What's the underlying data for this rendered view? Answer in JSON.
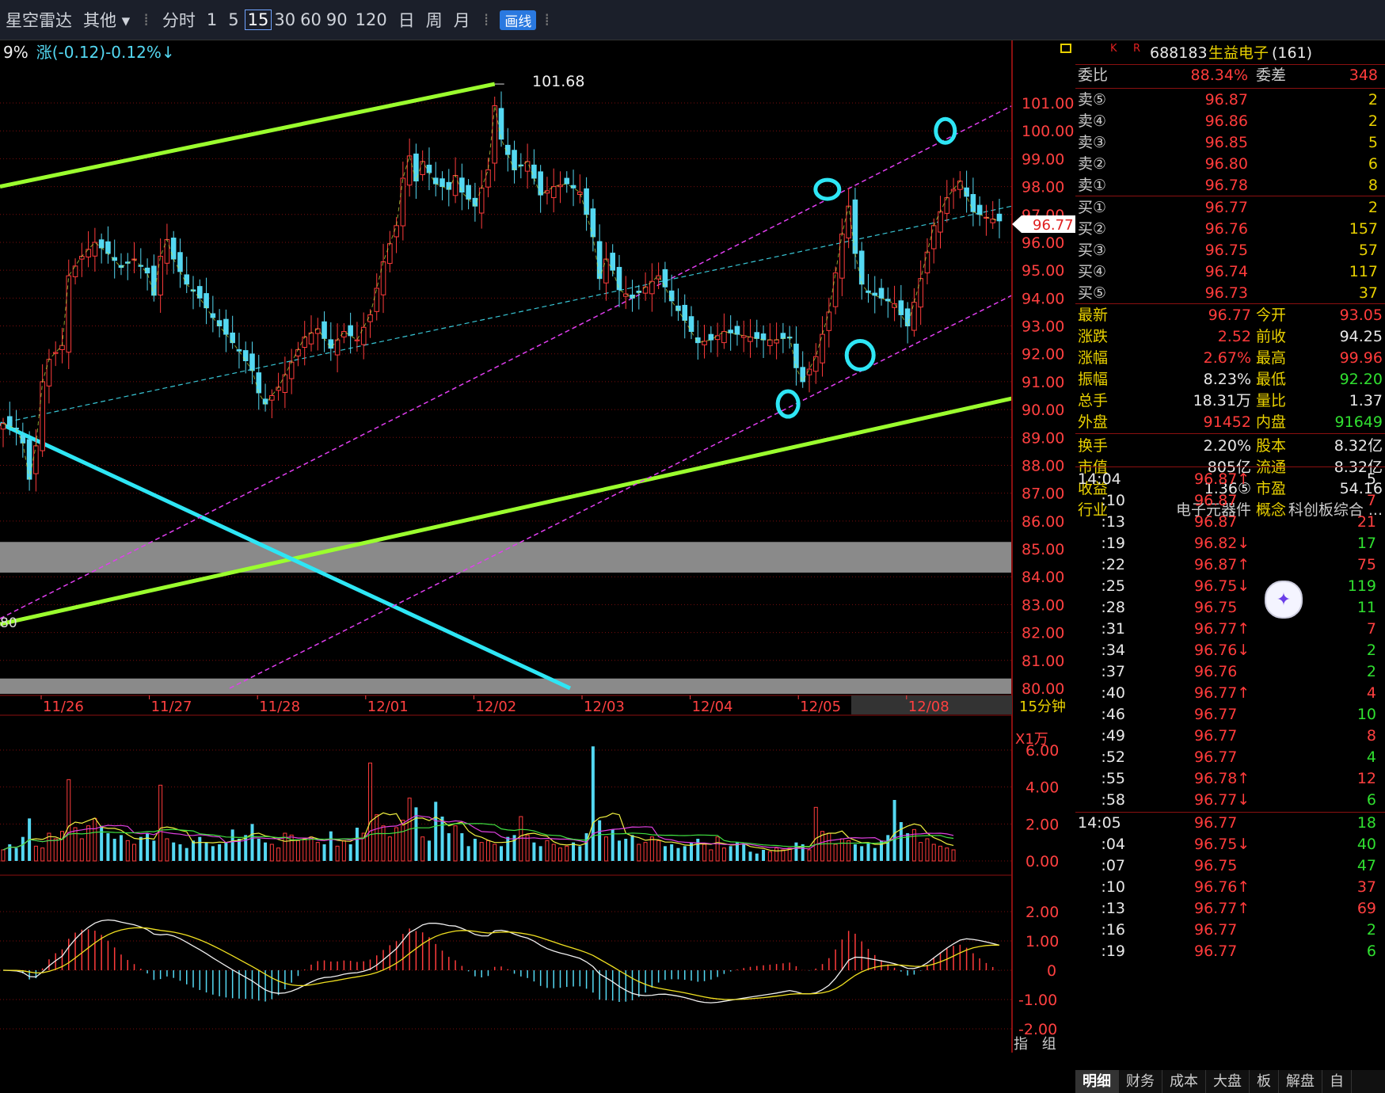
{
  "toolbar": {
    "app_name": "星空雷达",
    "menu_other": "其他",
    "periods": [
      "分时",
      "1",
      "5",
      "15",
      "30",
      "60",
      "90",
      "120",
      "日",
      "周",
      "月"
    ],
    "selected_period": "15",
    "draw_label": "画线"
  },
  "chart_header": {
    "pct_fragment": "9%",
    "change_text": "涨(-0.12)-0.12%↓"
  },
  "chart_data": {
    "type": "candlestick",
    "period_label": "15分钟",
    "x_labels": [
      "11/26",
      "11/27",
      "11/28",
      "12/01",
      "12/02",
      "12/03",
      "12/04",
      "12/05",
      "12/08"
    ],
    "price_ticks": [
      "101.00",
      "100.00",
      "99.00",
      "98.00",
      "97.00",
      "96.00",
      "95.00",
      "94.00",
      "93.00",
      "92.00",
      "91.00",
      "90.00",
      "89.00",
      "88.00",
      "87.00",
      "86.00",
      "85.00",
      "84.00",
      "83.00",
      "82.00",
      "81.00",
      "80.00"
    ],
    "ylim": [
      80,
      102
    ],
    "high_marker": "101.68",
    "current_price": "96.77",
    "left_edge_label": "80",
    "close_path": [
      [
        0,
        89.5
      ],
      [
        2,
        89.3
      ],
      [
        3,
        88.8
      ],
      [
        4,
        87.5
      ],
      [
        5,
        88.7
      ],
      [
        6,
        91.0
      ],
      [
        7,
        91.8
      ],
      [
        9,
        92.3
      ],
      [
        10,
        94.8
      ],
      [
        12,
        95.5
      ],
      [
        14,
        96.0
      ],
      [
        16,
        95.6
      ],
      [
        18,
        95.1
      ],
      [
        20,
        95.4
      ],
      [
        22,
        94.9
      ],
      [
        23,
        94.1
      ],
      [
        24,
        95.5
      ],
      [
        25,
        96.1
      ],
      [
        26,
        95.4
      ],
      [
        28,
        94.5
      ],
      [
        30,
        94.0
      ],
      [
        32,
        93.3
      ],
      [
        34,
        92.7
      ],
      [
        36,
        92.1
      ],
      [
        38,
        91.4
      ],
      [
        39,
        90.6
      ],
      [
        40,
        90.2
      ],
      [
        42,
        90.8
      ],
      [
        44,
        91.7
      ],
      [
        46,
        92.6
      ],
      [
        48,
        92.9
      ],
      [
        50,
        92.2
      ],
      [
        52,
        92.8
      ],
      [
        54,
        92.5
      ],
      [
        56,
        93.4
      ],
      [
        58,
        95.3
      ],
      [
        60,
        96.6
      ],
      [
        61,
        98.3
      ],
      [
        62,
        99.1
      ],
      [
        63,
        98.2
      ],
      [
        64,
        98.9
      ],
      [
        66,
        98.1
      ],
      [
        68,
        97.9
      ],
      [
        69,
        98.4
      ],
      [
        70,
        97.8
      ],
      [
        72,
        97.3
      ],
      [
        74,
        98.6
      ],
      [
        75,
        100.9
      ],
      [
        76,
        99.7
      ],
      [
        78,
        98.6
      ],
      [
        80,
        98.9
      ],
      [
        82,
        97.7
      ],
      [
        84,
        98.0
      ],
      [
        86,
        98.1
      ],
      [
        88,
        97.8
      ],
      [
        90,
        96.2
      ],
      [
        91,
        94.7
      ],
      [
        92,
        95.4
      ],
      [
        93,
        95.0
      ],
      [
        94,
        94.3
      ],
      [
        96,
        94.0
      ],
      [
        98,
        94.4
      ],
      [
        100,
        94.8
      ],
      [
        101,
        94.4
      ],
      [
        102,
        93.9
      ],
      [
        104,
        93.2
      ],
      [
        106,
        92.4
      ],
      [
        108,
        92.5
      ],
      [
        110,
        92.8
      ],
      [
        112,
        92.7
      ],
      [
        114,
        92.6
      ],
      [
        116,
        92.5
      ],
      [
        118,
        92.5
      ],
      [
        120,
        92.6
      ],
      [
        121,
        91.5
      ],
      [
        122,
        91.0
      ],
      [
        124,
        91.9
      ],
      [
        126,
        93.5
      ],
      [
        128,
        96.3
      ],
      [
        129,
        97.3
      ],
      [
        130,
        95.6
      ],
      [
        131,
        94.5
      ],
      [
        132,
        94.2
      ],
      [
        134,
        94.0
      ],
      [
        136,
        93.8
      ],
      [
        138,
        93.0
      ],
      [
        140,
        94.7
      ],
      [
        142,
        96.6
      ],
      [
        144,
        97.6
      ],
      [
        146,
        98.2
      ],
      [
        148,
        97.1
      ],
      [
        150,
        96.9
      ],
      [
        152,
        96.77
      ]
    ],
    "volume": {
      "scale_label": "X1万",
      "ticks": [
        "6.00",
        "4.00",
        "2.00",
        "0.00"
      ],
      "ylim": [
        0,
        7
      ],
      "values": [
        0.6,
        0.9,
        0.7,
        1.3,
        2.3,
        0.8,
        0.7,
        1.5,
        1.2,
        1.6,
        4.4,
        1.8,
        1.2,
        1.9,
        2.3,
        1.9,
        1.5,
        1.2,
        1.4,
        1.1,
        0.9,
        1.3,
        1.5,
        1.1,
        4.1,
        1.2,
        1.0,
        0.9,
        0.7,
        1.1,
        1.3,
        1.0,
        0.8,
        0.9,
        1.0,
        1.7,
        1.2,
        1.4,
        2.0,
        1.2,
        1.0,
        0.9,
        0.7,
        1.5,
        1.4,
        1.1,
        1.2,
        1.3,
        1.0,
        0.9,
        1.6,
        0.8,
        1.1,
        0.9,
        1.8,
        1.5,
        5.3,
        2.5,
        1.9,
        1.3,
        1.8,
        2.2,
        3.4,
        2.9,
        1.3,
        1.1,
        3.2,
        2.4,
        1.5,
        1.9,
        1.5,
        0.8,
        1.2,
        1.0,
        1.1,
        0.9,
        0.8,
        1.3,
        1.4,
        2.4,
        1.4,
        1.0,
        0.8,
        1.1,
        0.9,
        0.7,
        0.8,
        1.0,
        0.8,
        1.5,
        6.2,
        2.2,
        1.3,
        1.7,
        1.1,
        1.2,
        1.4,
        0.9,
        1.0,
        1.3,
        1.1,
        0.8,
        0.9,
        0.7,
        0.8,
        1.0,
        1.2,
        0.9,
        0.6,
        1.3,
        0.7,
        0.8,
        1.0,
        0.9,
        0.5,
        0.4,
        0.6,
        0.5,
        0.7,
        0.6,
        0.7,
        1.0,
        0.9,
        0.6,
        2.9,
        1.6,
        1.5,
        0.9,
        1.2,
        1.1,
        0.9,
        0.8,
        1.0,
        0.7,
        1.1,
        1.4,
        3.3,
        2.1,
        1.5,
        1.7,
        1.0,
        1.2,
        0.9,
        0.8,
        0.7,
        0.6
      ]
    },
    "macd": {
      "ticks": [
        "2.00",
        "1.00",
        "0",
        "-1.00",
        "-2.00"
      ],
      "ylim": [
        -2.2,
        2.2
      ]
    }
  },
  "info_panel": {
    "tabs_top": [
      "K",
      "R"
    ],
    "code": "688183",
    "name": "生益电子",
    "name_suffix": "(161)",
    "webi": {
      "label": "委比",
      "value": "88.34%",
      "diff_label": "委差",
      "diff_value": "348"
    },
    "asks": [
      {
        "label": "卖⑤",
        "price": "96.87",
        "vol": "2"
      },
      {
        "label": "卖④",
        "price": "96.86",
        "vol": "2"
      },
      {
        "label": "卖③",
        "price": "96.85",
        "vol": "5"
      },
      {
        "label": "卖②",
        "price": "96.80",
        "vol": "6"
      },
      {
        "label": "卖①",
        "price": "96.78",
        "vol": "8"
      }
    ],
    "bids": [
      {
        "label": "买①",
        "price": "96.77",
        "vol": "2"
      },
      {
        "label": "买②",
        "price": "96.76",
        "vol": "157"
      },
      {
        "label": "买③",
        "price": "96.75",
        "vol": "57"
      },
      {
        "label": "买④",
        "price": "96.74",
        "vol": "117"
      },
      {
        "label": "买⑤",
        "price": "96.73",
        "vol": "37"
      }
    ],
    "stats": [
      {
        "l1": "最新",
        "v1": "96.77",
        "l2": "今开",
        "v2": "93.05"
      },
      {
        "l1": "涨跌",
        "v1": "2.52",
        "l2": "前收",
        "v2": "94.25"
      },
      {
        "l1": "涨幅",
        "v1": "2.67%",
        "l2": "最高",
        "v2": "99.96"
      },
      {
        "l1": "振幅",
        "v1": "8.23%",
        "l2": "最低",
        "v2": "92.20"
      },
      {
        "l1": "总手",
        "v1": "18.31万",
        "l2": "量比",
        "v2": "1.37"
      },
      {
        "l1": "外盘",
        "v1": "91452",
        "l2": "内盘",
        "v2": "91649"
      },
      {
        "l1": "换手",
        "v1": "2.20%",
        "l2": "股本",
        "v2": "8.32亿"
      },
      {
        "l1": "市值",
        "v1": "805亿",
        "l2": "流通",
        "v2": "8.32亿"
      },
      {
        "l1": "收益",
        "v1": "1.36⑤",
        "l2": "市盈",
        "v2": "54.16"
      },
      {
        "l1": "行业",
        "v1": "电子元器件",
        "l2": "概念",
        "v2": "科创板综合 ..."
      }
    ],
    "ticks": [
      {
        "t": "14:04",
        "p": "96.87↑",
        "v": "5",
        "vc": "#e8e8e8"
      },
      {
        "t": ":10",
        "p": "96.87",
        "v": "7",
        "vc": "#ff4040"
      },
      {
        "t": ":13",
        "p": "96.87",
        "v": "21",
        "vc": "#ff4040"
      },
      {
        "t": ":19",
        "p": "96.82↓",
        "v": "17",
        "vc": "#30e030"
      },
      {
        "t": ":22",
        "p": "96.87↑",
        "v": "75",
        "vc": "#ff4040"
      },
      {
        "t": ":25",
        "p": "96.75↓",
        "v": "119",
        "vc": "#30e030"
      },
      {
        "t": ":28",
        "p": "96.75",
        "v": "11",
        "vc": "#30e030"
      },
      {
        "t": ":31",
        "p": "96.77↑",
        "v": "7",
        "vc": "#ff4040"
      },
      {
        "t": ":34",
        "p": "96.76↓",
        "v": "2",
        "vc": "#30e030"
      },
      {
        "t": ":37",
        "p": "96.76",
        "v": "2",
        "vc": "#30e030"
      },
      {
        "t": ":40",
        "p": "96.77↑",
        "v": "4",
        "vc": "#ff4040"
      },
      {
        "t": ":46",
        "p": "96.77",
        "v": "10",
        "vc": "#30e030"
      },
      {
        "t": ":49",
        "p": "96.77",
        "v": "8",
        "vc": "#ff4040"
      },
      {
        "t": ":52",
        "p": "96.77",
        "v": "4",
        "vc": "#30e030"
      },
      {
        "t": ":55",
        "p": "96.78↑",
        "v": "12",
        "vc": "#ff4040"
      },
      {
        "t": ":58",
        "p": "96.77↓",
        "v": "6",
        "vc": "#30e030"
      },
      {
        "t": "14:05",
        "p": "96.77",
        "v": "18",
        "vc": "#30e030"
      },
      {
        "t": ":04",
        "p": "96.75↓",
        "v": "40",
        "vc": "#30e030"
      },
      {
        "t": ":07",
        "p": "96.75",
        "v": "47",
        "vc": "#30e030"
      },
      {
        "t": ":10",
        "p": "96.76↑",
        "v": "37",
        "vc": "#ff4040"
      },
      {
        "t": ":13",
        "p": "96.77↑",
        "v": "69",
        "vc": "#ff4040"
      },
      {
        "t": ":16",
        "p": "96.77",
        "v": "2",
        "vc": "#30e030"
      },
      {
        "t": ":19",
        "p": "96.77",
        "v": "6",
        "vc": "#30e030"
      }
    ],
    "bottom_tabs": [
      "明细",
      "财务",
      "成本",
      "大盘",
      "板",
      "解盘",
      "自"
    ],
    "left_tabs": [
      "指",
      "组"
    ]
  },
  "colors": {
    "up": "#ff3b3b",
    "down": "#54d8f2",
    "grid": "#7a0d0d",
    "trend_green": "#9bff2e",
    "channel_magenta": "#e13ef0",
    "cyan_line": "#2ee6f5"
  }
}
